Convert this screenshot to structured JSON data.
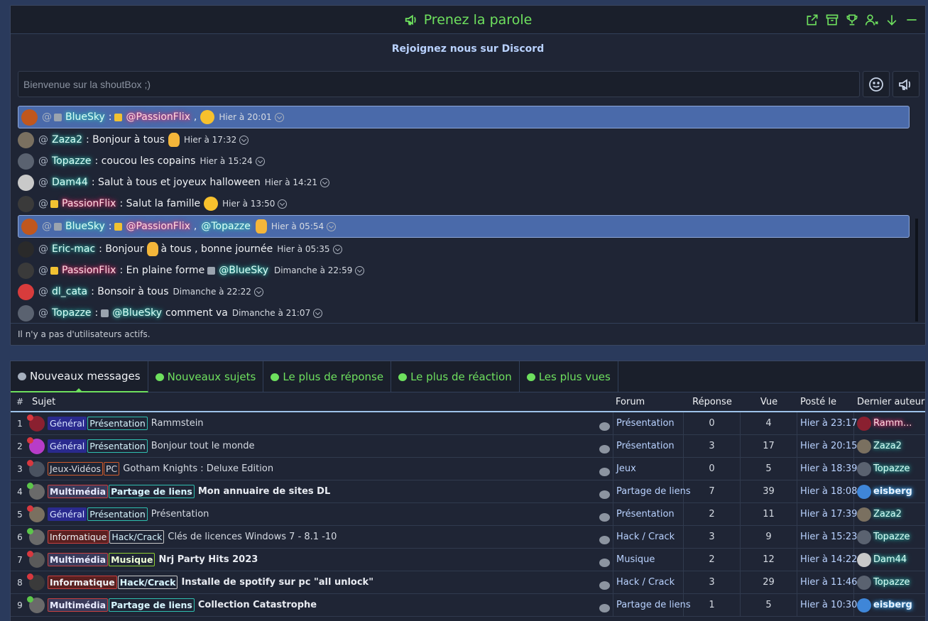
{
  "shoutbox": {
    "title": "Prenez la parole",
    "discord_banner": "Rejoignez nous sur Discord",
    "input_placeholder": "Bienvenue sur la shoutBox ;)",
    "footer": "Il n'y a pas d'utilisateurs actifs.",
    "messages": [
      {
        "nick": "BlueSky",
        "mention1": "@PassionFlix",
        "text": "",
        "time": "Hier à 20:01"
      },
      {
        "nick": "Zaza2",
        "text": ": Bonjour à tous",
        "time": "Hier à 17:32"
      },
      {
        "nick": "Topazze",
        "text": ": coucou les copains",
        "time": "Hier à 15:24"
      },
      {
        "nick": "Dam44",
        "text": ": Salut à tous et joyeux halloween",
        "time": "Hier à 14:21"
      },
      {
        "nick": "PassionFlix",
        "text": ": Salut la famille",
        "time": "Hier à 13:50"
      },
      {
        "nick": "BlueSky",
        "mention1": "@PassionFlix",
        "mention2": "@Topazze",
        "time": "Hier à 05:54"
      },
      {
        "nick": "Eric-mac",
        "text": ": Bonjour",
        "text2": "à tous , bonne journée",
        "time": "Hier à 05:35"
      },
      {
        "nick": "PassionFlix",
        "text": ": En plaine forme",
        "mention1": "@BlueSky",
        "time": "Dimanche à 22:59"
      },
      {
        "nick": "dl_cata",
        "text": ": Bonsoir à tous",
        "time": "Dimanche à 22:22"
      },
      {
        "nick": "Topazze",
        "mention1": "@BlueSky",
        "text": "comment va",
        "time": "Dimanche à 21:07"
      }
    ]
  },
  "forum": {
    "tabs": [
      "Nouveaux messages",
      "Nouveaux sujets",
      "Le plus de réponse",
      "Le plus de réaction",
      "Les plus vues"
    ],
    "headers": {
      "num": "#",
      "subject": "Sujet",
      "forum": "Forum",
      "replies": "Réponse",
      "views": "Vue",
      "posted": "Posté le",
      "author": "Dernier auteur"
    },
    "rows": [
      {
        "num": "1",
        "tags": [
          "Général",
          "Présentation"
        ],
        "title": "Rammstein",
        "forum": "Présentation",
        "replies": "0",
        "views": "4",
        "posted": "Hier à 23:17",
        "author": "Ramm..."
      },
      {
        "num": "2",
        "tags": [
          "Général",
          "Présentation"
        ],
        "title": "Bonjour tout le monde",
        "forum": "Présentation",
        "replies": "3",
        "views": "17",
        "posted": "Hier à 20:15",
        "author": "Zaza2"
      },
      {
        "num": "3",
        "tags": [
          "Jeux-Vidéos",
          "PC"
        ],
        "title": "Gotham Knights : Deluxe Edition",
        "forum": "Jeux",
        "replies": "0",
        "views": "5",
        "posted": "Hier à 18:39",
        "author": "Topazze"
      },
      {
        "num": "4",
        "tags": [
          "Multimédia",
          "Partage de liens"
        ],
        "title": "Mon annuaire de sites DL",
        "forum": "Partage de liens",
        "replies": "7",
        "views": "39",
        "posted": "Hier à 18:08",
        "author": "eisberg"
      },
      {
        "num": "5",
        "tags": [
          "Général",
          "Présentation"
        ],
        "title": "Présentation",
        "forum": "Présentation",
        "replies": "2",
        "views": "11",
        "posted": "Hier à 17:39",
        "author": "Zaza2"
      },
      {
        "num": "6",
        "tags": [
          "Informatique",
          "Hack/Crack"
        ],
        "title": "Clés de licences Windows 7 - 8.1 -10",
        "forum": "Hack / Crack",
        "replies": "3",
        "views": "9",
        "posted": "Hier à 15:23",
        "author": "Topazze"
      },
      {
        "num": "7",
        "tags": [
          "Multimédia",
          "Musique"
        ],
        "title": "Nrj Party Hits 2023",
        "forum": "Musique",
        "replies": "2",
        "views": "12",
        "posted": "Hier à 14:22",
        "author": "Dam44"
      },
      {
        "num": "8",
        "tags": [
          "Informatique",
          "Hack/Crack"
        ],
        "title": "Installe de spotify sur pc \"all unlock\"",
        "forum": "Hack / Crack",
        "replies": "3",
        "views": "29",
        "posted": "Hier à 11:46",
        "author": "Topazze"
      },
      {
        "num": "9",
        "tags": [
          "Multimédia",
          "Partage de liens"
        ],
        "title": "Collection Catastrophe",
        "forum": "Partage de liens",
        "replies": "1",
        "views": "5",
        "posted": "Hier à 10:30",
        "author": "eisberg"
      }
    ]
  }
}
